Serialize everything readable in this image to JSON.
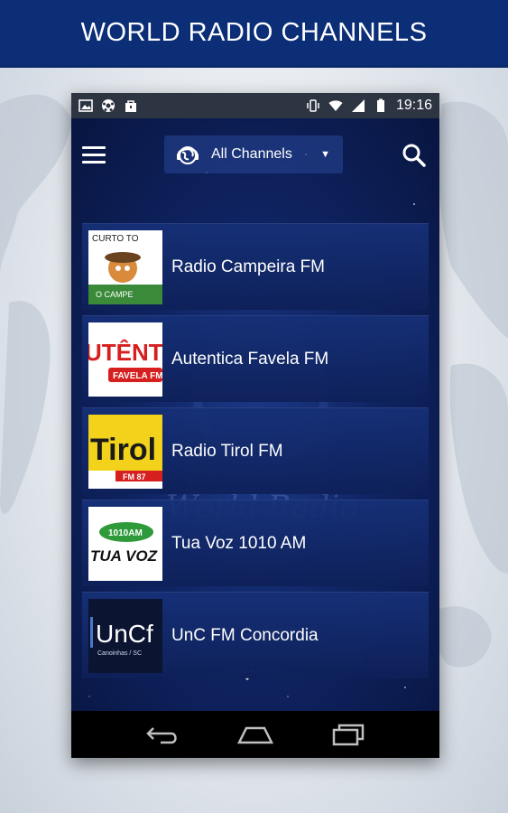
{
  "banner": {
    "title": "WORLD RADIO CHANNELS"
  },
  "status_bar": {
    "time": "19:16"
  },
  "toolbar": {
    "channel_filter": "All Channels"
  },
  "watermark": {
    "text": "World Radio"
  },
  "stations": [
    {
      "name": "Radio Campeira FM",
      "logo_text": "CURTO TO",
      "logo_sub": "O CAMPE"
    },
    {
      "name": "Autentica Favela FM",
      "logo_text": "UTÊNTICA",
      "logo_sub": "FAVELA FM"
    },
    {
      "name": "Radio Tirol FM",
      "logo_text": "Tirol",
      "logo_sub": "FM 87"
    },
    {
      "name": "Tua Voz 1010 AM",
      "logo_text": "1010AM",
      "logo_sub": "TUA VOZ"
    },
    {
      "name": "UnC FM Concordia",
      "logo_text": "UnCf",
      "logo_sub": "Canoinhas / SC"
    }
  ],
  "colors": {
    "banner": "#0b2e77",
    "accent": "#1c3a8a"
  }
}
